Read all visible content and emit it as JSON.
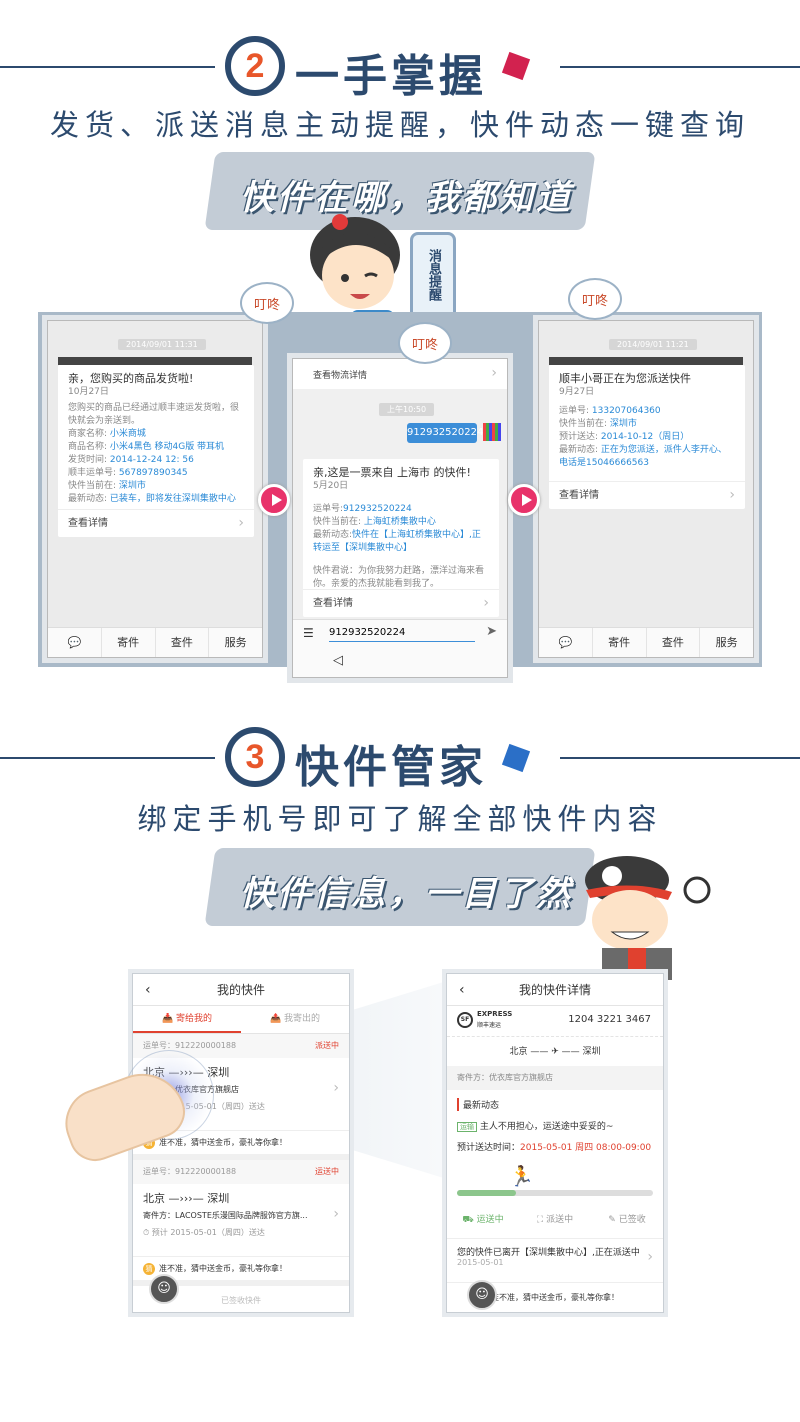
{
  "section2": {
    "number": "2",
    "title": "一手掌握",
    "subtitle": "发货、派送消息主动提醒，快件动态一键查询",
    "banner": "快件在哪，我都知道",
    "mascot_phone": "消息提醒",
    "dingdong": "叮咚",
    "phone_left": {
      "time": "2014/09/01 11:31",
      "card_title": "亲，您购买的商品发货啦!",
      "card_date": "10月27日",
      "card_desc": "您购买的商品已经通过顺丰速运发货啦，很快就会为亲送到。",
      "rows": [
        {
          "k": "商家名称:",
          "v": "小米商城"
        },
        {
          "k": "商品名称:",
          "v": "小米4黑色 移动4G版 带耳机"
        },
        {
          "k": "发货时间:",
          "v": "2014-12-24 12: 56"
        },
        {
          "k": "顺丰运单号:",
          "v": "567897890345"
        },
        {
          "k": "快件当前在:",
          "v": "深圳市"
        },
        {
          "k": "最新动态:",
          "v": "已装车，即将发往深圳集散中心"
        }
      ],
      "detail": "查看详情"
    },
    "phone_mid": {
      "top_link": "查看物流详情",
      "time": "上午10:50",
      "msg": "912932520224",
      "card_title": "亲,这是一票来自 上海市 的快件!",
      "card_date": "5月20日",
      "waybill_k": "运单号:",
      "waybill_v": "912932520224",
      "loc_k": "快件当前在:",
      "loc_v": "上海虹桥集散中心",
      "latest_k": "最新动态:",
      "latest_v": "快件在【上海虹桥集散中心】,正转运至【深圳集散中心】",
      "quote": "快件君说：为你我努力赶路，漂洋过海来看你。亲爱的杰我就能看到我了。",
      "detail": "查看详情",
      "input_value": "912932520224"
    },
    "phone_right": {
      "time": "2014/09/01 11:21",
      "card_title": "顺丰小哥正在为您派送快件",
      "card_date": "9月27日",
      "rows": [
        {
          "k": "运单号:",
          "v": "133207064360"
        },
        {
          "k": "快件当前在:",
          "v": "深圳市"
        },
        {
          "k": "预计送达:",
          "v": "2014-10-12（周日）"
        },
        {
          "k": "最新动态:",
          "v": "正在为您派送，派件人李开心、电话是15046666563"
        }
      ],
      "detail": "查看详情"
    },
    "tabs": [
      "寄件",
      "查件",
      "服务"
    ]
  },
  "section3": {
    "number": "3",
    "title": "快件管家",
    "subtitle": "绑定手机号即可了解全部快件内容",
    "banner": "快件信息，一目了然",
    "phone_left": {
      "title": "我的快件",
      "tab_active": "寄给我的",
      "tab_inactive": "我寄出的",
      "items": [
        {
          "waybill": "运单号：912220000188",
          "status": "派送中",
          "from": "北京",
          "to": "深圳",
          "sender": "寄件方：优衣库官方旗舰店",
          "eta": "预计 2015-05-01（周四）送达",
          "promo": "准不准，猜中送金币，豪礼等你拿！"
        },
        {
          "waybill": "运单号：912220000188",
          "status": "运送中",
          "from": "北京",
          "to": "深圳",
          "sender": "寄件方：LACOSTE乐漫国际品牌服饰官方旗...",
          "eta": "预计 2015-05-01（周四）送达",
          "promo": "准不准，猜中送金币，豪礼等你拿！"
        }
      ],
      "footer": "已签收快件"
    },
    "phone_right": {
      "title": "我的快件详情",
      "logo_text": "EXPRESS",
      "logo_sub": "顺丰速运",
      "waybill": "1204 3221 3467",
      "from": "北京",
      "to": "深圳",
      "sender": "寄件方：优衣库官方旗舰店",
      "latest_label": "最新动态",
      "tag": "运输",
      "msg": "主人不用担心，运送途中妥妥的~",
      "eta_label": "预计送达时间：",
      "eta_value": "2015-05-01 周四  08:00-09:00",
      "steps": [
        "运送中",
        "派送中",
        "已签收"
      ],
      "status_text": "您的快件已离开【深圳集散中心】,正在派送中",
      "status_date": "2015-05-01",
      "promo": "准不准，猜中送金币，豪礼等你拿！"
    }
  },
  "colors": {
    "navy": "#2c4a6e",
    "accent_orange": "#e8562a",
    "link_blue": "#2a8ad6",
    "red": "#e0412f",
    "pink": "#e8326a"
  }
}
